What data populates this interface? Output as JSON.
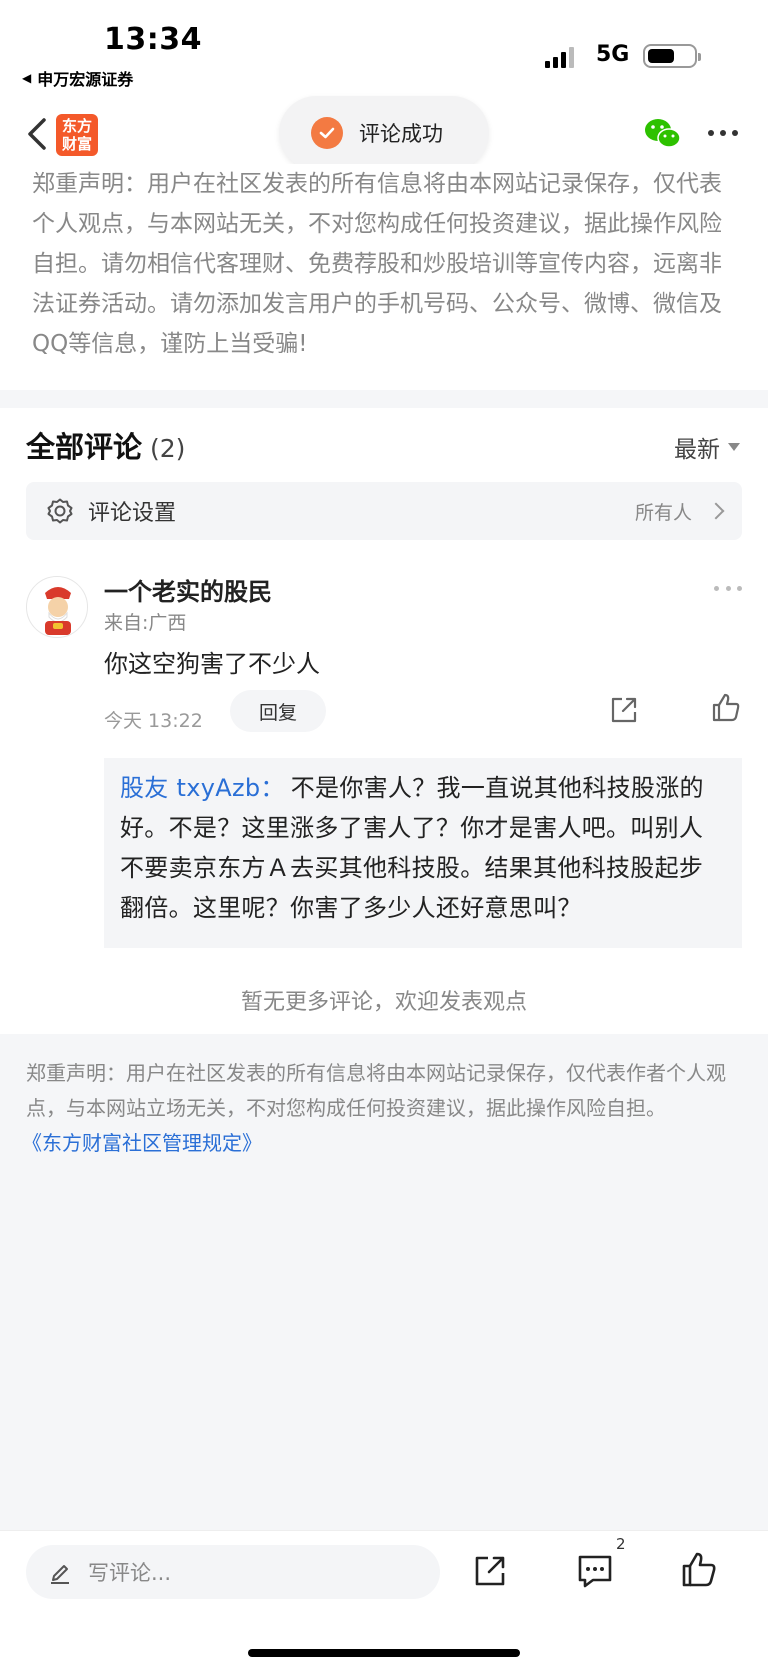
{
  "status_bar": {
    "time": "13:34",
    "back_app": "申万宏源证券",
    "network": "5G"
  },
  "nav": {
    "logo_text_line1": "东方",
    "logo_text_line2": "财富",
    "toast": "评论成功"
  },
  "disclaimer_top": "郑重声明：用户在社区发表的所有信息将由本网站记录保存，仅代表个人观点，与本网站无关，不对您构成任何投资建议，据此操作风险自担。请勿相信代客理财、免费荐股和炒股培训等宣传内容，远离非法证券活动。请勿添加发言用户的手机号码、公众号、微博、微信及QQ等信息，谨防上当受骗!",
  "comments": {
    "title": "全部评论",
    "count": "(2)",
    "sort": "最新",
    "settings_label": "评论设置",
    "settings_value": "所有人",
    "items": [
      {
        "username": "一个老实的股民",
        "location": "来自:广西",
        "text": "你这空狗害了不少人",
        "time": "今天 13:22",
        "reply_label": "回复",
        "reply": {
          "user": "股友 txyAzb",
          "colon": "：",
          "text": "不是你害人？我一直说其他科技股涨的好。不是？这里涨多了害人了？你才是害人吧。叫别人不要卖京东方Ａ去买其他科技股。结果其他科技股起步翻倍。这里呢？你害了多少人还好意思叫？"
        }
      }
    ],
    "no_more": "暂无更多评论，欢迎发表观点"
  },
  "disclaimer_bottom": {
    "text": "郑重声明：用户在社区发表的所有信息将由本网站记录保存，仅代表作者个人观点，与本网站立场无关，不对您构成任何投资建议，据此操作风险自担。",
    "link": "《东方财富社区管理规定》"
  },
  "bottom_bar": {
    "input_placeholder": "写评论...",
    "comment_badge": "2"
  },
  "colors": {
    "brand_orange": "#f4592a",
    "link_blue": "#2a6fd6",
    "toast_check": "#f37a42"
  }
}
